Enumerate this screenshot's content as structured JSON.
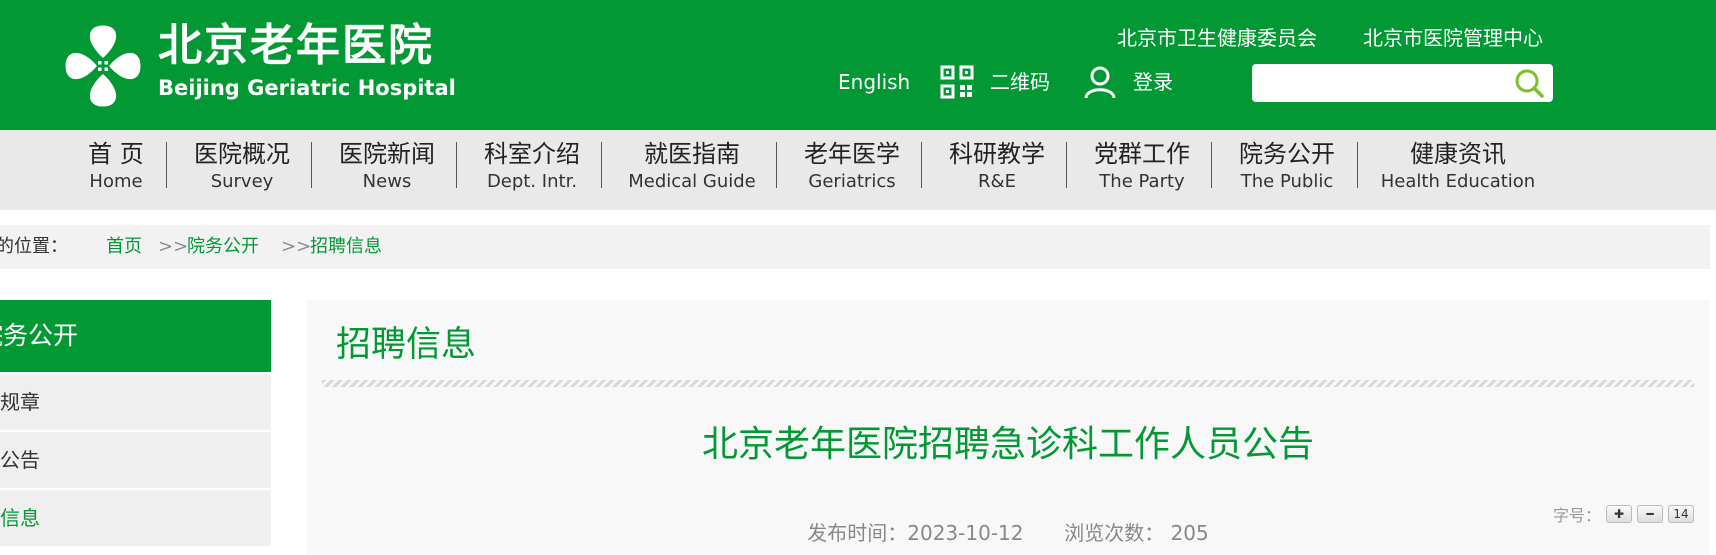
{
  "header": {
    "logo_cn": "北京老年医院",
    "logo_en": "Beijing Geriatric Hospital",
    "top_links": [
      "北京市卫生健康委员会",
      "北京市医院管理中心"
    ],
    "english_label": "English",
    "qrcode_label": "二维码",
    "login_label": "登录",
    "search_placeholder": ""
  },
  "nav": [
    {
      "cn": "首 页",
      "en": "Home"
    },
    {
      "cn": "医院概况",
      "en": "Survey"
    },
    {
      "cn": "医院新闻",
      "en": "News"
    },
    {
      "cn": "科室介绍",
      "en": "Dept. Intr."
    },
    {
      "cn": "就医指南",
      "en": "Medical Guide"
    },
    {
      "cn": "老年医学",
      "en": "Geriatrics"
    },
    {
      "cn": "科研教学",
      "en": "R&E"
    },
    {
      "cn": "党群工作",
      "en": "The Party"
    },
    {
      "cn": "院务公开",
      "en": "The Public"
    },
    {
      "cn": "健康资讯",
      "en": "Health Education"
    }
  ],
  "breadcrumb": {
    "prefix": "您的位置：",
    "items": [
      "首页",
      "院务公开",
      "招聘信息"
    ],
    "separator": ">>"
  },
  "sidebar": {
    "title": "院务公开",
    "items": [
      "医院规章",
      "公示公告",
      "招聘信息"
    ]
  },
  "main": {
    "section_title": "招聘信息",
    "article_title": "北京老年医院招聘急诊科工作人员公告",
    "publish_label": "发布时间：",
    "publish_date": "2023-10-12",
    "views_label": "浏览次数：",
    "views_count": "205",
    "font_size_label": "字号：",
    "font_size_value": "14"
  },
  "colors": {
    "brand_green": "#029934",
    "nav_bg": "#e9e9e9",
    "crumb_bg": "#f2f2f2"
  }
}
